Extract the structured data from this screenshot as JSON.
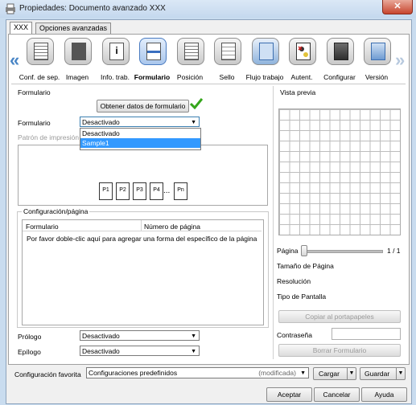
{
  "window": {
    "title": "Propiedades: Documento avanzado XXX",
    "close": "✕"
  },
  "tabs": [
    {
      "label": "XXX"
    },
    {
      "label": "Opciones avanzadas"
    }
  ],
  "ribbon": {
    "prev": "«",
    "next": "»",
    "items": [
      {
        "label": "Conf. de sep.",
        "icon": "separator-settings-icon"
      },
      {
        "label": "Imagen",
        "icon": "image-icon"
      },
      {
        "label": "Info. trab.",
        "icon": "job-info-icon"
      },
      {
        "label": "Formulario",
        "icon": "form-icon",
        "selected": true
      },
      {
        "label": "Posición",
        "icon": "position-icon"
      },
      {
        "label": "Sello",
        "icon": "stamp-icon"
      },
      {
        "label": "Flujo trabajo",
        "icon": "workflow-icon"
      },
      {
        "label": "Autent.",
        "icon": "authentication-icon"
      },
      {
        "label": "Configurar",
        "icon": "configure-icon"
      },
      {
        "label": "Versión",
        "icon": "version-icon"
      }
    ]
  },
  "form": {
    "group_label": "Formulario",
    "get_data_button": "Obtener datos de formulario",
    "form_label": "Formulario",
    "form_value": "Desactivado",
    "dropdown_options": [
      "Desactivado",
      "Sample1"
    ],
    "pattern_label": "Patrón de impresión",
    "pages": [
      "P1",
      "P2",
      "P3",
      "P4",
      "...",
      "Pn"
    ]
  },
  "config_page": {
    "group_label": "Configuración/página",
    "columns": [
      "Formulario",
      "Número de página"
    ],
    "hint": "Por favor doble-clic aquí para agregar una forma del específico de la página"
  },
  "prologue": {
    "label": "Prólogo",
    "value": "Desactivado"
  },
  "epilogue": {
    "label": "Epílogo",
    "value": "Desactivado"
  },
  "preview": {
    "label": "Vista previa",
    "page_label": "Página",
    "page_value": "1 / 1",
    "page_size": "Tamaño de Página",
    "resolution": "Resolución",
    "screen_type": "Tipo de Pantalla",
    "copy_button": "Copiar al portapapeles",
    "password_label": "Contraseña",
    "delete_button": "Borrar Formulario"
  },
  "favorites": {
    "label": "Configuración favorita",
    "value": "Configuraciones predefinidos",
    "modified": "(modificada)",
    "load": "Cargar",
    "save": "Guardar"
  },
  "footer": {
    "accept": "Aceptar",
    "cancel": "Cancelar",
    "help": "Ayuda"
  },
  "colors": {
    "accent": "#3399ff",
    "check": "#35a61b"
  }
}
